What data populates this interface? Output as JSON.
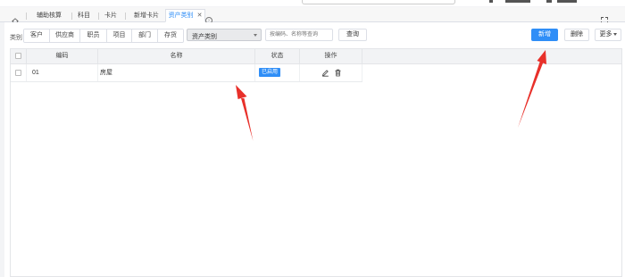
{
  "tabs": [
    {
      "label": "辅助核算"
    },
    {
      "label": "科目"
    },
    {
      "label": "卡片"
    },
    {
      "label": "新增卡片"
    },
    {
      "label": "资产类别",
      "active": true
    }
  ],
  "toolbar": {
    "category_label": "类别",
    "categories": [
      "客户",
      "供应商",
      "职员",
      "项目",
      "部门",
      "存货"
    ],
    "category_select_value": "资产类别",
    "search_placeholder": "按编码、名称等查询",
    "query_label": "查询",
    "new_label": "新增",
    "delete_label": "删除",
    "more_label": "更多"
  },
  "table": {
    "columns": [
      "编码",
      "名称",
      "状态",
      "操作"
    ],
    "rows": [
      {
        "code": "01",
        "name": "房屋",
        "status": "已启用"
      }
    ]
  },
  "colors": {
    "accent": "#2f8ef7",
    "annotation_arrow": "#e8302a"
  },
  "icons": [
    "home-icon",
    "close-icon",
    "more-tabs-icon",
    "expand-icon",
    "dropdown-arrow-icon",
    "edit-icon",
    "trash-icon"
  ]
}
